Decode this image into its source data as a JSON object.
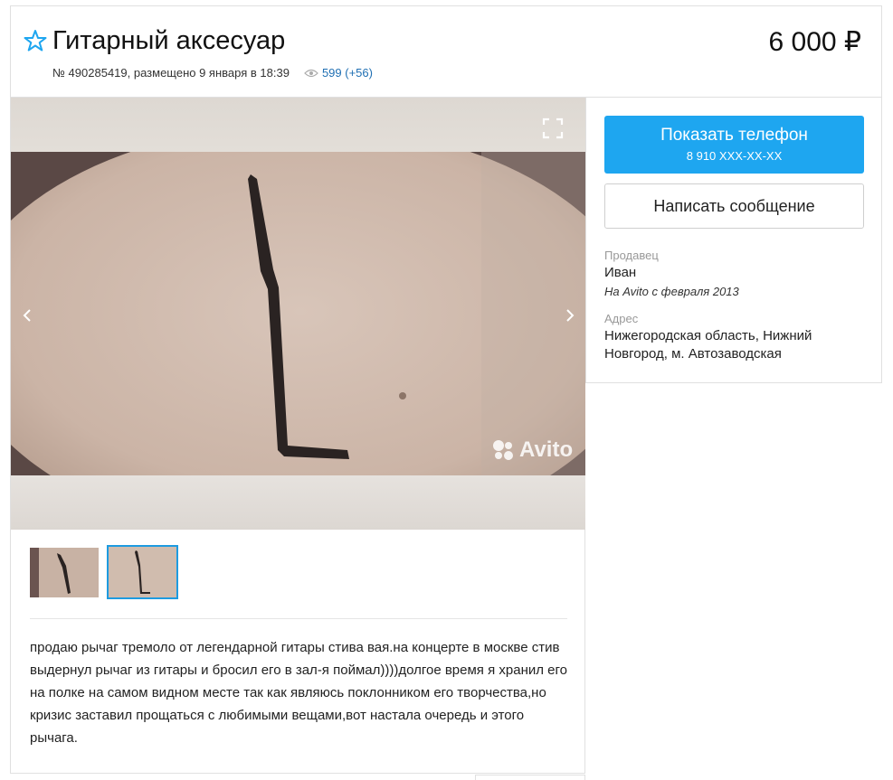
{
  "listing": {
    "title": "Гитарный аксесуар",
    "price": "6 000 ₽",
    "meta": "№ 490285419, размещено 9 января в 18:39",
    "views": "599 (+56)"
  },
  "gallery": {
    "watermark": "Avito",
    "thumbnails": [
      "thumb-1",
      "thumb-2"
    ],
    "selected_thumbnail": 2
  },
  "description": "продаю рычаг тремоло от легендарной гитары стива вая.на концерте в москве стив выдернул рычаг из гитары и бросил его в зал-я поймал))))долгое время я хранил его на полке на самом видном месте так как являюсь поклонником его творчества,но кризис заставил прощаться с любимыми вещами,вот настала очередь и этого рычага.",
  "contact": {
    "show_phone_label": "Показать телефон",
    "phone_masked": "8 910 XXX-XX-XX",
    "message_label": "Написать сообщение"
  },
  "seller": {
    "label": "Продавец",
    "name": "Иван",
    "since": "На Avito с февраля 2013"
  },
  "address": {
    "label": "Адрес",
    "value": "Нижегородская область, Нижний Новгород, м. Автозаводская"
  },
  "colors": {
    "accent": "#1ea6f0",
    "link": "#1f6fb3"
  },
  "icons": [
    "star-icon",
    "eye-icon",
    "fullscreen-icon",
    "chevron-left-icon",
    "chevron-right-icon",
    "avito-logo-icon"
  ]
}
